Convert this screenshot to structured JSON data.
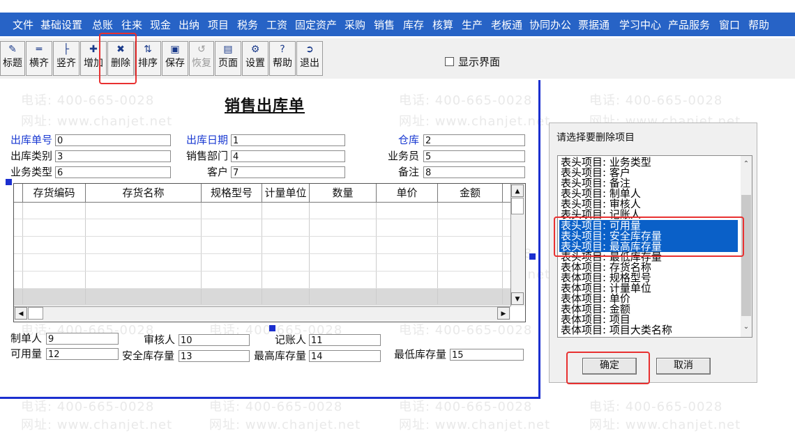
{
  "menu": [
    "文件",
    "基础设置",
    "总账",
    "往来",
    "现金",
    "出纳",
    "项目",
    "税务",
    "工资",
    "固定资产",
    "采购",
    "销售",
    "库存",
    "核算",
    "生产",
    "老板通",
    "协同办公",
    "票据通",
    "学习中心",
    "产品服务",
    "窗口",
    "帮助"
  ],
  "toolbar": {
    "title": "标题",
    "h_align": "横齐",
    "v_align": "竖齐",
    "add": "增加",
    "delete": "删除",
    "sort": "排序",
    "save": "保存",
    "restore": "恢复",
    "page": "页面",
    "settings": "设置",
    "help": "帮助",
    "exit": "退出"
  },
  "show_interface": "显示界面",
  "form": {
    "title": "销售出库单",
    "out_no_label": "出库单号",
    "out_no_value": "0",
    "out_date_label": "出库日期",
    "out_date_value": "1",
    "warehouse_label": "仓库",
    "warehouse_value": "2",
    "out_type_label": "出库类别",
    "out_type_value": "3",
    "sales_dept_label": "销售部门",
    "sales_dept_value": "4",
    "salesman_label": "业务员",
    "salesman_value": "5",
    "biz_type_label": "业务类型",
    "biz_type_value": "6",
    "customer_label": "客户",
    "customer_value": "7",
    "remark_label": "备注",
    "remark_value": "8",
    "maker_label": "制单人",
    "maker_value": "9",
    "reviewer_label": "审核人",
    "reviewer_value": "10",
    "bookkeeper_label": "记账人",
    "bookkeeper_value": "11",
    "available_label": "可用量",
    "available_value": "12",
    "safety_stock_label": "安全库存量",
    "safety_stock_value": "13",
    "max_stock_label": "最高库存量",
    "max_stock_value": "14",
    "min_stock_label": "最低库存量",
    "min_stock_value": "15"
  },
  "grid": {
    "columns": [
      "存货编码",
      "存货名称",
      "规格型号",
      "计量单位",
      "数量",
      "单价",
      "金额"
    ]
  },
  "dialog": {
    "title": "请选择要删除项目",
    "items": [
      "表头项目:  业务类型",
      "表头项目:  客户",
      "表头项目:  备注",
      "表头项目:  制单人",
      "表头项目:  审核人",
      "表头项目:  记账人",
      "表头项目:  可用量",
      "表头项目:  安全库存量",
      "表头项目:  最高库存量",
      "表头项目:  最低库存量",
      "表体项目:  存货名称",
      "表体项目:  规格型号",
      "表体项目:  计量单位",
      "表体项目:  单价",
      "表体项目:  金额",
      "表体项目:  项目",
      "表体项目:  项目大类名称"
    ],
    "ok": "确定",
    "cancel": "取消"
  },
  "watermark": {
    "phone": "电话: 400-665-0028",
    "site": "网址: www.chanjet.net"
  },
  "colors": {
    "menubar": "#2763c6",
    "selection": "#0a60c8",
    "highlight": "#e83030",
    "border_blue": "#1b2fcf"
  }
}
